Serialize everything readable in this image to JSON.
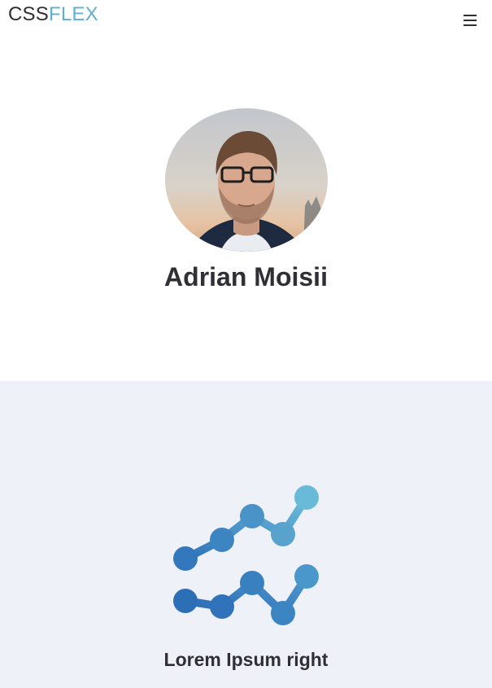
{
  "header": {
    "logo_part1": "CSS",
    "logo_part2": "FLEX",
    "menu_icon": "hamburger-menu-icon"
  },
  "hero": {
    "name": "Adrian Moisii",
    "avatar_icon": "profile-photo"
  },
  "feature": {
    "icon": "line-chart-icon",
    "title": "Lorem Ipsum right"
  },
  "colors": {
    "accent": "#5fb0d3",
    "text": "#2f2f35",
    "section_bg": "#eff1f8",
    "chart_light": "#69b9d8",
    "chart_dark": "#2d6fb7"
  }
}
